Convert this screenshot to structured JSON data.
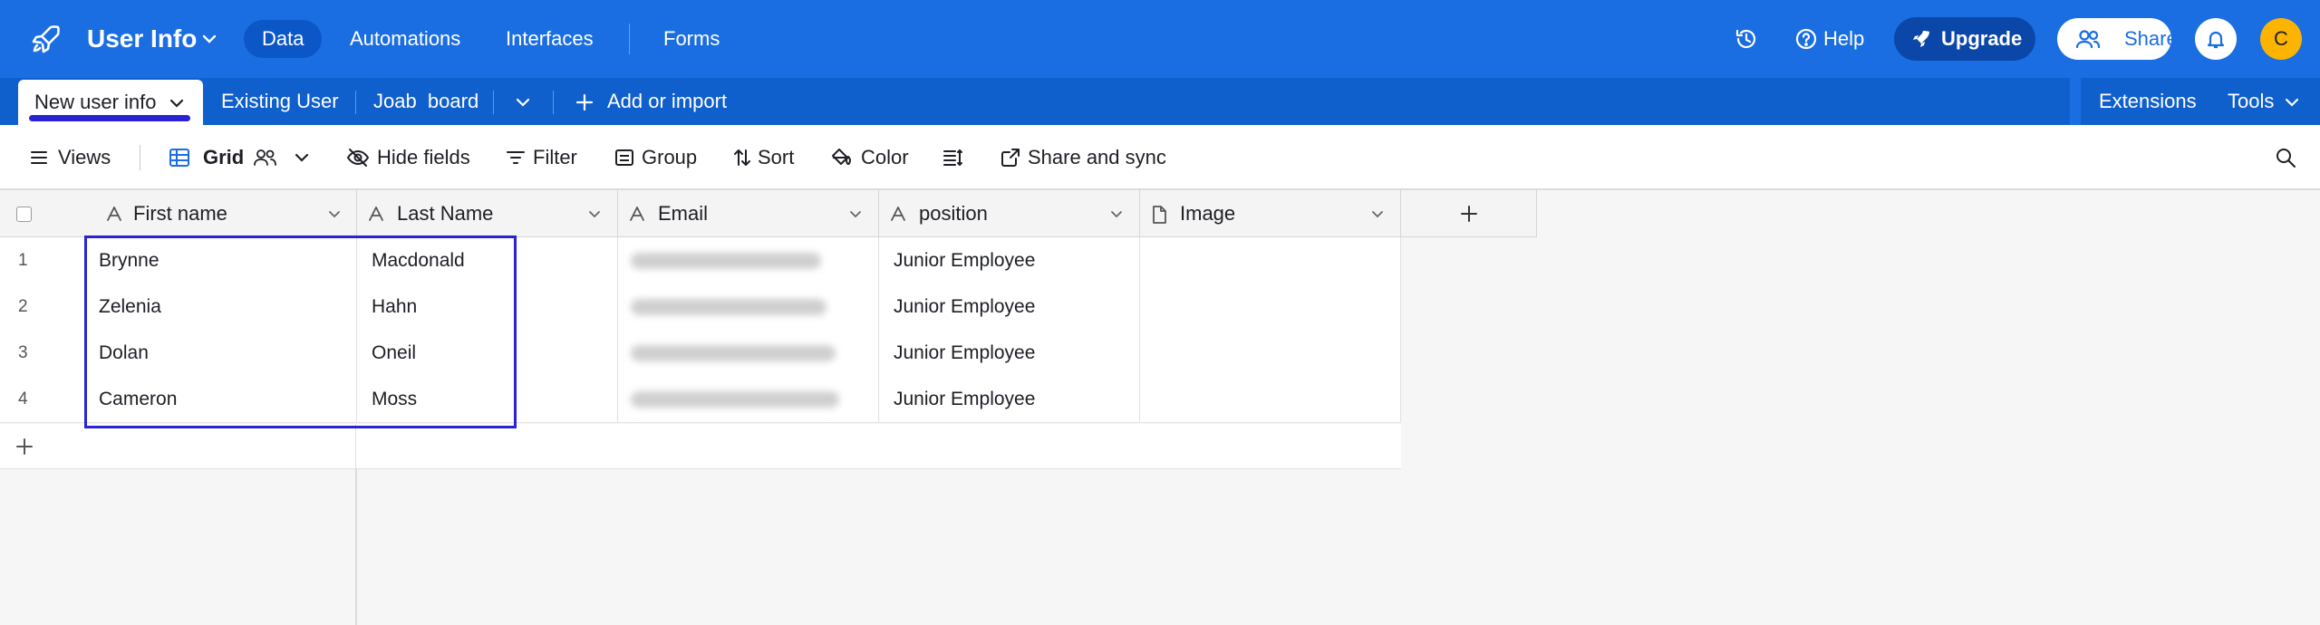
{
  "app": {
    "base_title": "User Info",
    "nav": [
      "Data",
      "Automations",
      "Interfaces",
      "Forms"
    ],
    "help_label": "Help",
    "upgrade_label": "Upgrade",
    "share_label": "Share",
    "avatar_initial": "C",
    "accent_color": "#1a6ee2",
    "selection_color": "#2a22d3"
  },
  "tables": {
    "active": "New user info",
    "others": [
      "Existing User",
      "Joab  board"
    ],
    "add_label": "Add or import",
    "extensions_label": "Extensions",
    "tools_label": "Tools"
  },
  "toolbar": {
    "views_label": "Views",
    "view_name": "Grid",
    "hide_fields": "Hide fields",
    "filter": "Filter",
    "group": "Group",
    "sort": "Sort",
    "color": "Color",
    "share_sync": "Share and sync"
  },
  "grid": {
    "columns": [
      {
        "label": "First name",
        "type": "text"
      },
      {
        "label": "Last Name",
        "type": "text"
      },
      {
        "label": "Email",
        "type": "text"
      },
      {
        "label": "position",
        "type": "text"
      },
      {
        "label": "Image",
        "type": "attachment"
      }
    ],
    "rows": [
      {
        "num": "1",
        "first": "Brynne",
        "last": "Macdonald",
        "position": "Junior Employee"
      },
      {
        "num": "2",
        "first": "Zelenia",
        "last": "Hahn",
        "position": "Junior Employee"
      },
      {
        "num": "3",
        "first": "Dolan",
        "last": "Oneil",
        "position": "Junior Employee"
      },
      {
        "num": "4",
        "first": "Cameron",
        "last": "Moss",
        "position": "Junior Employee"
      }
    ]
  }
}
